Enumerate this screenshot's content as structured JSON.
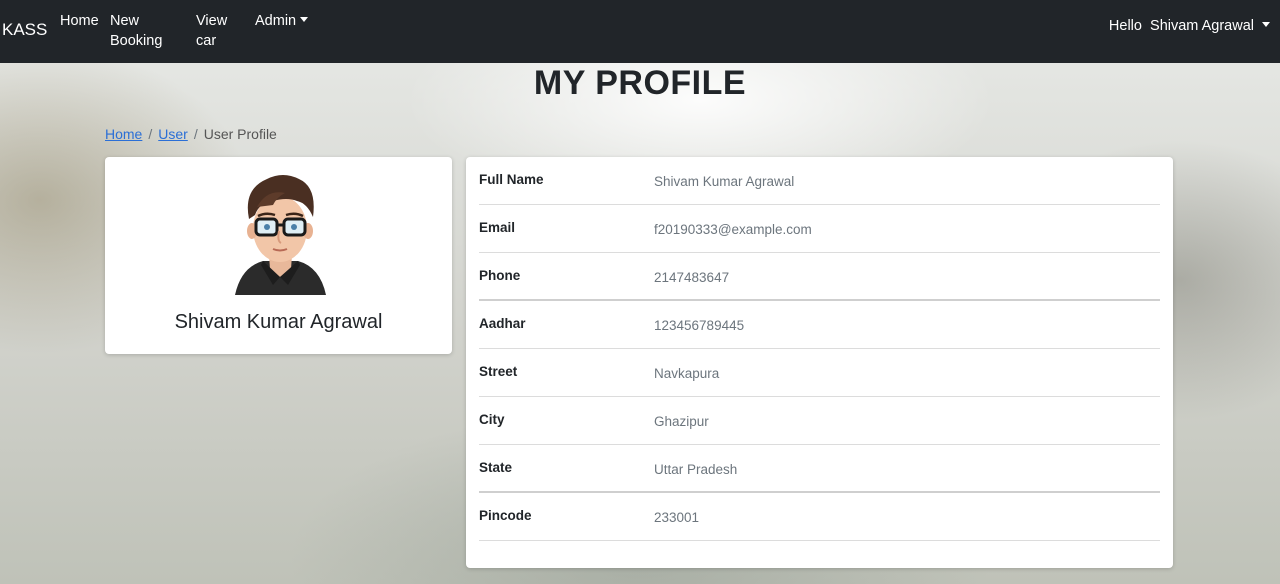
{
  "nav": {
    "brand": "KASS",
    "items": [
      {
        "label": "Home"
      },
      {
        "label": "New Booking"
      },
      {
        "label": "View car"
      },
      {
        "label": "Admin"
      }
    ],
    "user_greeting": "Hello  Shivam Agrawal"
  },
  "page": {
    "title": "MY PROFILE"
  },
  "breadcrumb": [
    {
      "label": "Home"
    },
    {
      "label": "User"
    },
    {
      "label": "User Profile"
    }
  ],
  "profile": {
    "name": "Shivam Kumar Agrawal",
    "fields": [
      {
        "label": "Full Name",
        "value": "Shivam Kumar Agrawal"
      },
      {
        "label": "Email",
        "value": "f20190333@example.com"
      },
      {
        "label": "Phone",
        "value": "2147483647"
      },
      {
        "label": "Aadhar",
        "value": "123456789445"
      },
      {
        "label": "Street",
        "value": "Navkapura"
      },
      {
        "label": "City",
        "value": "Ghazipur"
      },
      {
        "label": "State",
        "value": "Uttar Pradesh"
      },
      {
        "label": "Pincode",
        "value": "233001"
      }
    ]
  },
  "colors": {
    "navbar": "#212529",
    "link": "#2b6fd6",
    "muted_text": "#6c757d"
  },
  "icons": {
    "avatar": "user-avatar-illustration",
    "dropdown": "caret-down-icon"
  }
}
